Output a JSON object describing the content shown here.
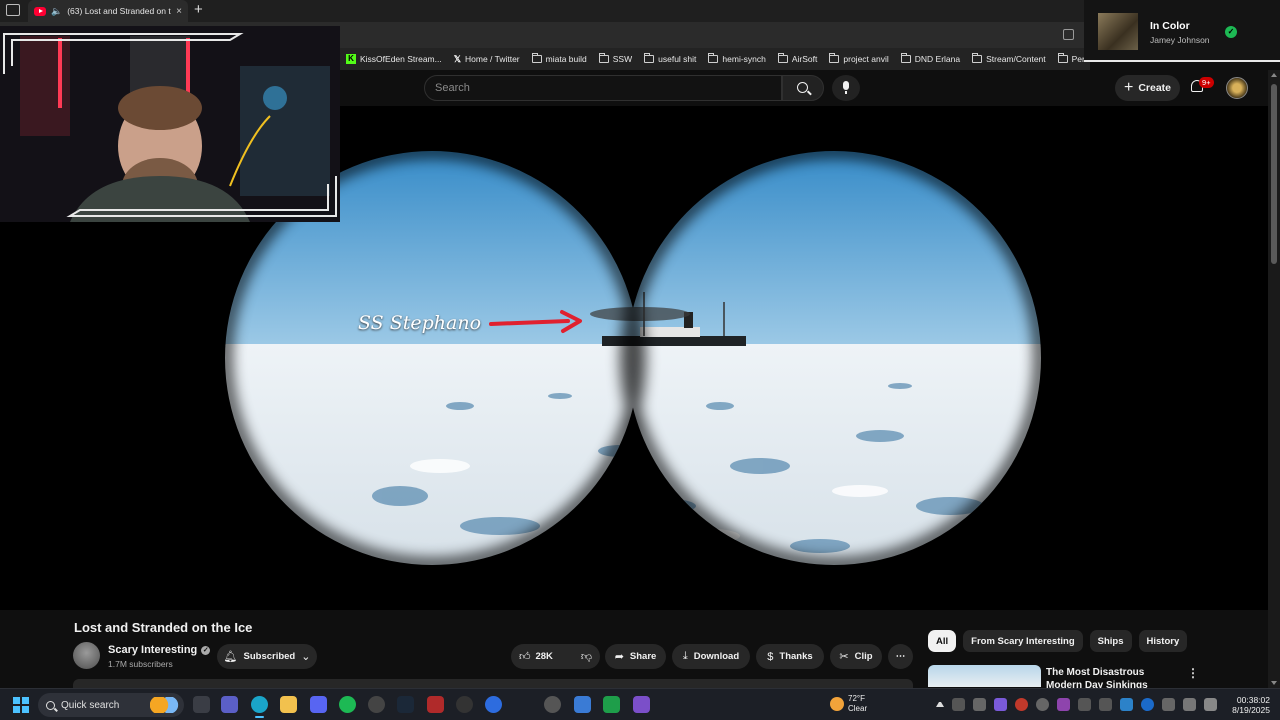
{
  "browser": {
    "tab_title": "(63) Lost and Stranded on th",
    "tab_close": "×",
    "new_tab": "+",
    "bookmarks": [
      {
        "label": "KissOfEden Stream...",
        "icon": "kick-icon"
      },
      {
        "label": "Home / Twitter",
        "icon": "x-icon"
      },
      {
        "label": "miata build",
        "icon": "folder-icon"
      },
      {
        "label": "SSW",
        "icon": "folder-icon"
      },
      {
        "label": "useful shit",
        "icon": "folder-icon"
      },
      {
        "label": "hemi-synch",
        "icon": "folder-icon"
      },
      {
        "label": "AirSoft",
        "icon": "folder-icon"
      },
      {
        "label": "project anvil",
        "icon": "folder-icon"
      },
      {
        "label": "DND Erlana",
        "icon": "folder-icon"
      },
      {
        "label": "Stream/Content",
        "icon": "folder-icon"
      },
      {
        "label": "Personal DI",
        "icon": "folder-icon"
      }
    ]
  },
  "youtube": {
    "search_placeholder": "Search",
    "create_label": "Create",
    "notifications_badge": "9+",
    "video": {
      "title": "Lost and Stranded on the Ice",
      "overlay_caption": "SS Stephano"
    },
    "channel": {
      "name": "Scary Interesting",
      "subscribers": "1.7M subscribers",
      "subscribed_label": "Subscribed"
    },
    "actions": {
      "likes": "28K",
      "share": "Share",
      "download": "Download",
      "thanks": "Thanks",
      "clip": "Clip",
      "more": "⋯"
    },
    "chips": [
      "All",
      "From Scary Interesting",
      "Ships",
      "History"
    ],
    "recommendation": {
      "title": "The Most Disastrous Modern Day Sinkings"
    }
  },
  "now_playing": {
    "title": "In Color",
    "artist": "Jamey Johnson"
  },
  "taskbar": {
    "search_label": "Quick search",
    "weather_temp": "72°F",
    "weather_desc": "Clear",
    "time": "00:38:02",
    "date": "8/19/2025"
  },
  "colors": {
    "youtube_red": "#ff0033",
    "accent_blue": "#4cc2ff",
    "spotify_green": "#1db954",
    "arrow_red": "#e0212f"
  }
}
